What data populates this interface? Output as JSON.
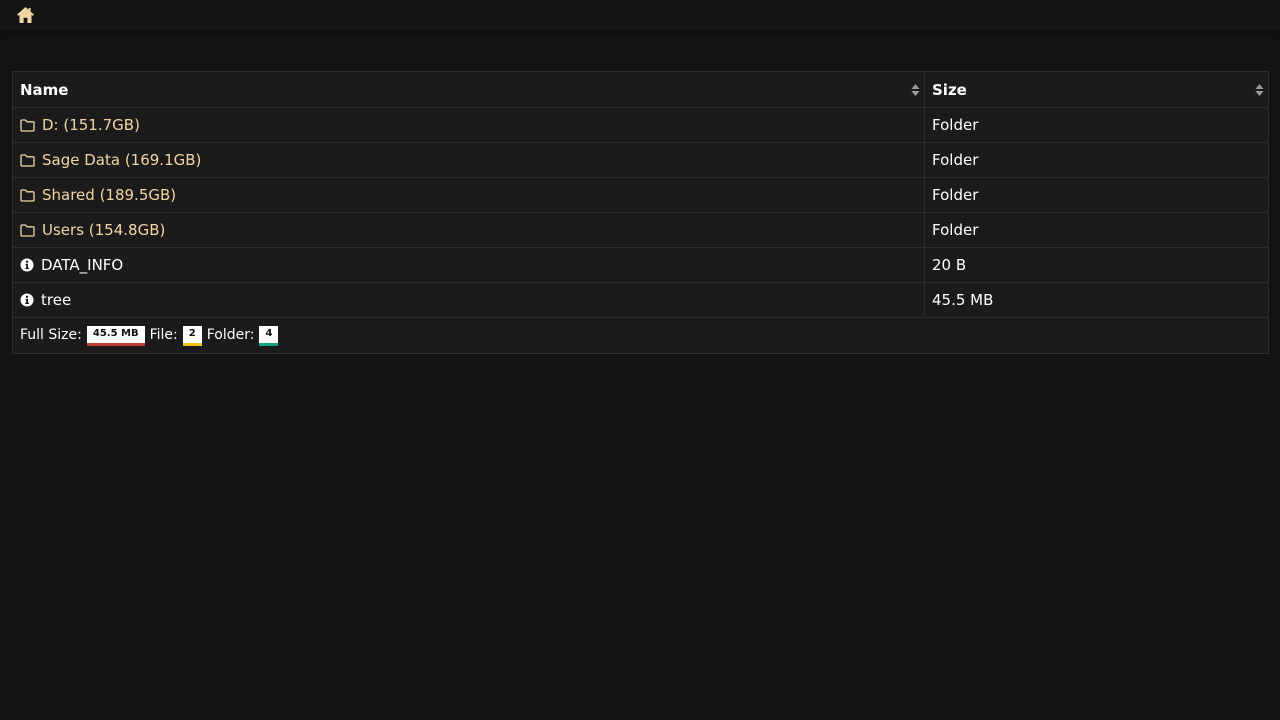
{
  "header": {
    "home_icon": "home-icon"
  },
  "table": {
    "columns": [
      {
        "label": "Name"
      },
      {
        "label": "Size"
      }
    ],
    "rows": [
      {
        "type": "folder",
        "icon": "folder-icon",
        "name": "D: (151.7GB)",
        "size": "Folder"
      },
      {
        "type": "folder",
        "icon": "folder-icon",
        "name": "Sage Data (169.1GB)",
        "size": "Folder"
      },
      {
        "type": "folder",
        "icon": "folder-icon",
        "name": "Shared (189.5GB)",
        "size": "Folder"
      },
      {
        "type": "folder",
        "icon": "folder-icon",
        "name": "Users (154.8GB)",
        "size": "Folder"
      },
      {
        "type": "file",
        "icon": "info-icon",
        "name": "DATA_INFO",
        "size": "20 B"
      },
      {
        "type": "file",
        "icon": "info-icon",
        "name": "tree",
        "size": "45.5 MB"
      }
    ]
  },
  "footer": {
    "full_size_label": "Full Size:",
    "full_size_value": "45.5 MB",
    "file_label": "File:",
    "file_count": "2",
    "folder_label": "Folder:",
    "folder_count": "4"
  },
  "colors": {
    "background": "#121212",
    "folder_text": "#f3d5a4",
    "full_size_underline": "#c0392b",
    "file_underline": "#f1c40f",
    "folder_underline": "#16a085"
  }
}
